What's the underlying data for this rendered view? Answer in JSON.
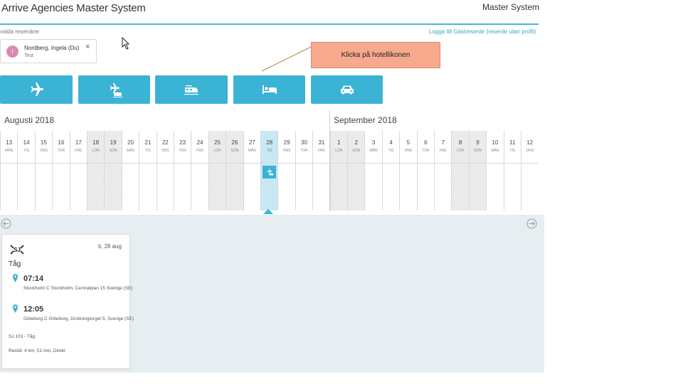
{
  "header": {
    "title": "Arrive Agencies Master System",
    "subtitle": "Master System"
  },
  "travelers": {
    "label": "valda resenärer",
    "guest_link": "Logga till Gästresenär (resenär utan profil)",
    "selected": {
      "initial": "I",
      "name": "Nordberg, Ingela (Du)",
      "sub": "Test",
      "close": "×"
    }
  },
  "annotation": {
    "callout_text": "Klicka på hotellikonen"
  },
  "modes": [
    {
      "icon": "plane-icon"
    },
    {
      "icon": "plane-train-icon"
    },
    {
      "icon": "train-icon"
    },
    {
      "icon": "hotel-bed-icon"
    },
    {
      "icon": "car-icon"
    }
  ],
  "calendar": {
    "months": [
      "Augusti 2018",
      "September 2018"
    ],
    "days": [
      {
        "num": "13",
        "name": "MÅN",
        "weekend": false
      },
      {
        "num": "14",
        "name": "TIS",
        "weekend": false
      },
      {
        "num": "15",
        "name": "ONS",
        "weekend": false
      },
      {
        "num": "16",
        "name": "TOR",
        "weekend": false
      },
      {
        "num": "17",
        "name": "FRE",
        "weekend": false
      },
      {
        "num": "18",
        "name": "LÖR",
        "weekend": true
      },
      {
        "num": "19",
        "name": "SÖN",
        "weekend": true
      },
      {
        "num": "20",
        "name": "MÅN",
        "weekend": false
      },
      {
        "num": "21",
        "name": "TIS",
        "weekend": false
      },
      {
        "num": "22",
        "name": "ONS",
        "weekend": false
      },
      {
        "num": "23",
        "name": "TOR",
        "weekend": false
      },
      {
        "num": "24",
        "name": "FRE",
        "weekend": false
      },
      {
        "num": "25",
        "name": "LÖR",
        "weekend": true
      },
      {
        "num": "26",
        "name": "SÖN",
        "weekend": true
      },
      {
        "num": "27",
        "name": "MÅN",
        "weekend": false
      },
      {
        "num": "28",
        "name": "TIS",
        "weekend": false,
        "selected": true
      },
      {
        "num": "29",
        "name": "ONS",
        "weekend": false
      },
      {
        "num": "30",
        "name": "TOR",
        "weekend": false
      },
      {
        "num": "31",
        "name": "FRE",
        "weekend": false
      },
      {
        "num": "1",
        "name": "LÖR",
        "weekend": true
      },
      {
        "num": "2",
        "name": "SÖN",
        "weekend": true
      },
      {
        "num": "3",
        "name": "MÅN",
        "weekend": false
      },
      {
        "num": "4",
        "name": "TIS",
        "weekend": false
      },
      {
        "num": "5",
        "name": "ONS",
        "weekend": false
      },
      {
        "num": "6",
        "name": "TOR",
        "weekend": false
      },
      {
        "num": "7",
        "name": "FRE",
        "weekend": false
      },
      {
        "num": "8",
        "name": "LÖR",
        "weekend": true
      },
      {
        "num": "9",
        "name": "SÖN",
        "weekend": true
      },
      {
        "num": "10",
        "name": "MÅN",
        "weekend": false
      },
      {
        "num": "11",
        "name": "TIS",
        "weekend": false
      },
      {
        "num": "12",
        "name": "ONS",
        "weekend": false
      }
    ]
  },
  "trip": {
    "date": "ti, 28 aug",
    "type": "Tåg",
    "departure": {
      "time": "07:14",
      "address": "Stockholm C Stockholm, Centralplan 15 Sverige (SE)"
    },
    "arrival": {
      "time": "12:05",
      "address": "Göteborg C Göteborg, Drottningtorget 5, Sverige (SE)"
    },
    "train": "SJ 103 - Tåg",
    "duration": "Restid: 4 tim, 51 min, Direkt"
  },
  "colors": {
    "accent": "#3bb3d5",
    "callout": "#f6a98c",
    "panel": "#e7eef1"
  }
}
